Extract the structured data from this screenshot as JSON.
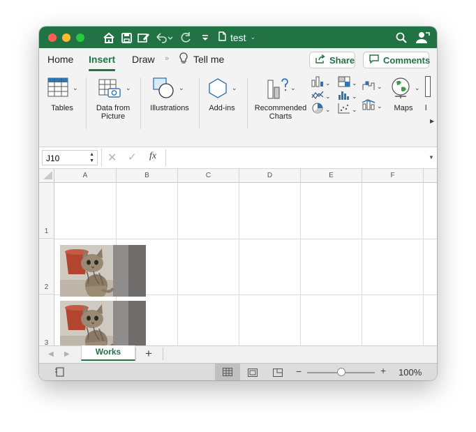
{
  "window": {
    "title": "test",
    "colors": {
      "accent": "#217346",
      "close": "#fe5f57",
      "minimize": "#febc2e",
      "zoom": "#28c840"
    }
  },
  "titlebar_icons": [
    "home-icon",
    "save-icon",
    "edit-icon",
    "undo-icon",
    "redo-icon",
    "customize-icon",
    "document-icon",
    "search-icon",
    "share-person-icon"
  ],
  "tabs": {
    "items": [
      "Home",
      "Insert",
      "Draw"
    ],
    "active": "Insert",
    "tell_me": "Tell me",
    "share": "Share",
    "comments": "Comments"
  },
  "ribbon": {
    "tables": "Tables",
    "data_from_picture_line1": "Data from",
    "data_from_picture_line2": "Picture",
    "illustrations": "Illustrations",
    "addins": "Add-ins",
    "recommended_charts_line1": "Recommended",
    "recommended_charts_line2": "Charts",
    "maps": "Maps"
  },
  "formula_bar": {
    "name_box": "J10",
    "fx": "fx",
    "formula": ""
  },
  "grid": {
    "columns": [
      "A",
      "B",
      "C",
      "D",
      "E",
      "F"
    ],
    "rows": [
      "1",
      "2",
      "3"
    ],
    "images": [
      "kitten-photo",
      "kitten-photo"
    ]
  },
  "sheets": {
    "tabs": [
      "Works"
    ],
    "active": "Works",
    "add": "+"
  },
  "status": {
    "zoom": "100%",
    "zoom_fraction": 0.5,
    "views": [
      "normal-view-icon",
      "page-layout-view-icon",
      "page-break-view-icon"
    ]
  }
}
